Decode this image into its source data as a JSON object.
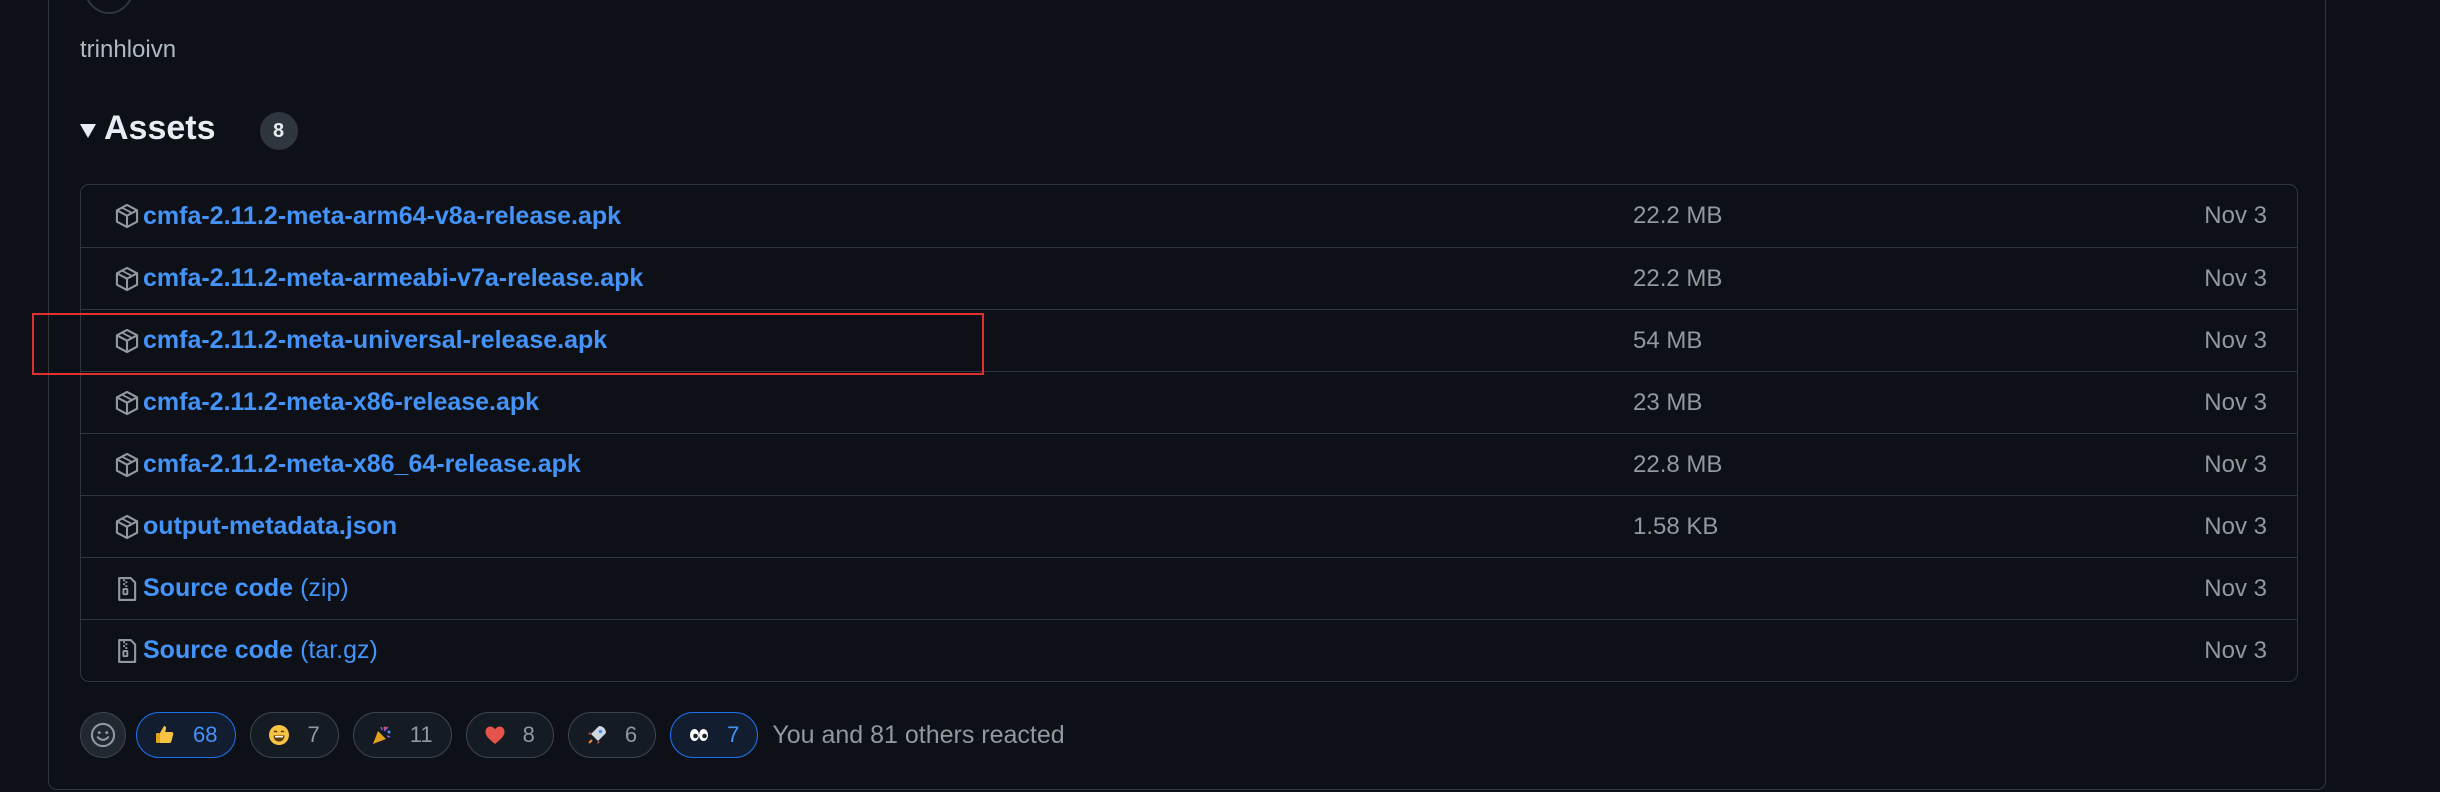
{
  "release": {
    "author": "trinhloivn"
  },
  "assets": {
    "title": "Assets",
    "count": "8",
    "items": [
      {
        "name": "cmfa-2.11.2-meta-arm64-v8a-release.apk",
        "suffix": "",
        "size": "22.2 MB",
        "date": "Nov 3",
        "icon": "package-icon"
      },
      {
        "name": "cmfa-2.11.2-meta-armeabi-v7a-release.apk",
        "suffix": "",
        "size": "22.2 MB",
        "date": "Nov 3",
        "icon": "package-icon"
      },
      {
        "name": "cmfa-2.11.2-meta-universal-release.apk",
        "suffix": "",
        "size": "54 MB",
        "date": "Nov 3",
        "icon": "package-icon"
      },
      {
        "name": "cmfa-2.11.2-meta-x86-release.apk",
        "suffix": "",
        "size": "23 MB",
        "date": "Nov 3",
        "icon": "package-icon"
      },
      {
        "name": "cmfa-2.11.2-meta-x86_64-release.apk",
        "suffix": "",
        "size": "22.8 MB",
        "date": "Nov 3",
        "icon": "package-icon"
      },
      {
        "name": "output-metadata.json",
        "suffix": "",
        "size": "1.58 KB",
        "date": "Nov 3",
        "icon": "package-icon"
      },
      {
        "name": "Source code",
        "suffix": "(zip)",
        "size": "",
        "date": "Nov 3",
        "icon": "file-zip-icon"
      },
      {
        "name": "Source code",
        "suffix": "(tar.gz)",
        "size": "",
        "date": "Nov 3",
        "icon": "file-zip-icon"
      }
    ]
  },
  "reactions": {
    "items": [
      {
        "emoji": "thumbs-up-icon",
        "count": "68",
        "active": true
      },
      {
        "emoji": "laugh-icon",
        "count": "7",
        "active": false
      },
      {
        "emoji": "hooray-icon",
        "count": "11",
        "active": false
      },
      {
        "emoji": "heart-icon",
        "count": "8",
        "active": false
      },
      {
        "emoji": "rocket-icon",
        "count": "6",
        "active": false
      },
      {
        "emoji": "eyes-icon",
        "count": "7",
        "active": true
      }
    ],
    "summary": "You and 81 others reacted"
  },
  "colors": {
    "background": "#0d1117",
    "link": "#4493f8",
    "border": "#30363d",
    "muted": "#9198a1",
    "highlight": "#e03131"
  }
}
